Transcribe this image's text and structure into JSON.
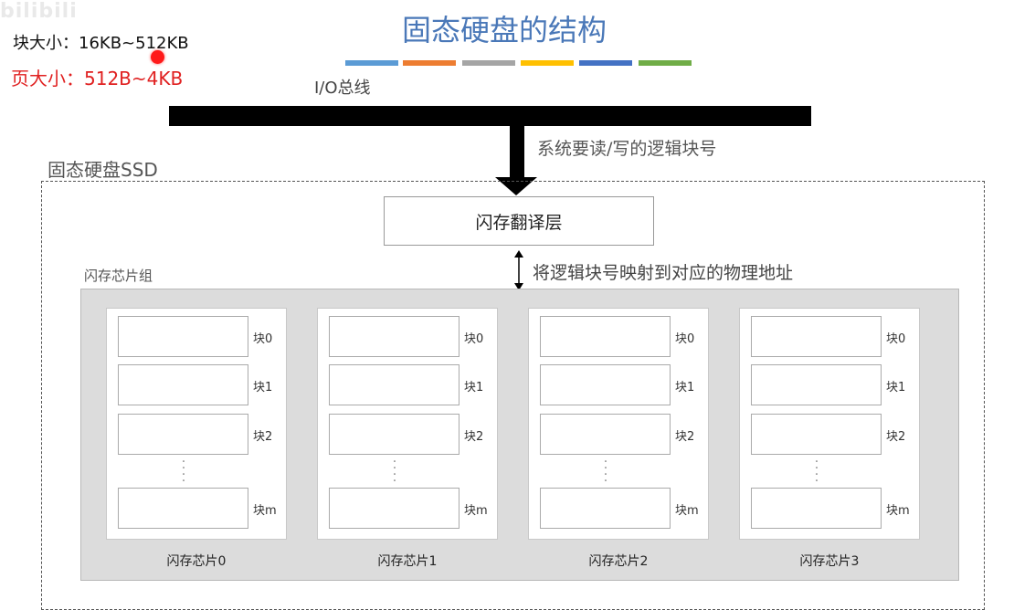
{
  "watermark": {
    "text": "bilibili"
  },
  "notes": {
    "block_size": "块大小：16KB~512KB",
    "page_size": "页大小：512B~4KB"
  },
  "header": {
    "title": "固态硬盘的结构",
    "color_bars": [
      "#5b9bd5",
      "#ed7d31",
      "#a5a5a5",
      "#ffc000",
      "#4472c4",
      "#70ad47"
    ]
  },
  "bus": {
    "label": "I/O总线",
    "request_label": "系统要读/写的逻辑块号"
  },
  "ssd": {
    "label": "固态硬盘SSD",
    "ftl_label": "闪存翻译层",
    "mapping_label": "将逻辑块号映射到对应的物理地址",
    "group_label": "闪存芯片组",
    "chips": [
      {
        "label": "闪存芯片0",
        "blocks": [
          "块0",
          "块1",
          "块2",
          "块m"
        ]
      },
      {
        "label": "闪存芯片1",
        "blocks": [
          "块0",
          "块1",
          "块2",
          "块m"
        ]
      },
      {
        "label": "闪存芯片2",
        "blocks": [
          "块0",
          "块1",
          "块2",
          "块m"
        ]
      },
      {
        "label": "闪存芯片3",
        "blocks": [
          "块0",
          "块1",
          "块2",
          "块m"
        ]
      }
    ]
  }
}
